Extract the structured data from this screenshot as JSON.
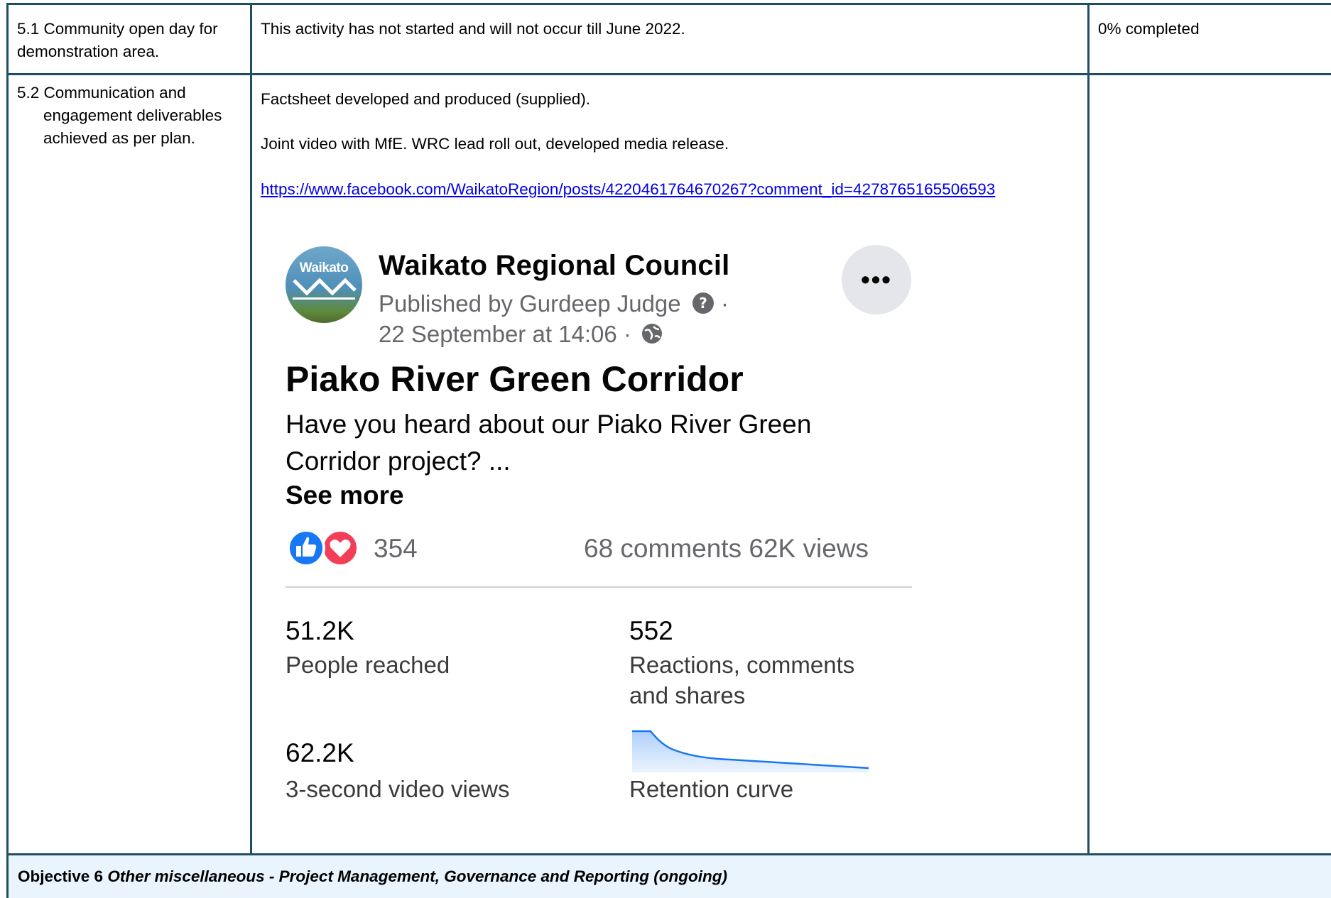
{
  "rows": [
    {
      "activity": "5.1 Community open day for demonstration area.",
      "activity_lines": [
        "5.1 Community open day for",
        "demonstration area."
      ],
      "progress": "This activity has not started and will not occur till June 2022.",
      "status": "0% completed"
    },
    {
      "activity_lines": [
        "5.2 Communication and",
        "engagement deliverables",
        "achieved as per plan."
      ],
      "progress_lines": [
        "Factsheet developed and produced (supplied).",
        "Joint video with MfE. WRC lead roll out, developed media release."
      ],
      "link": "https://www.facebook.com/WaikatoRegion/posts/4220461764670267?comment_id=4278765165506593",
      "status": ""
    }
  ],
  "facebook_post": {
    "logo_text": "Waikato",
    "page_name": "Waikato Regional Council",
    "published_by": "Published by Gurdeep Judge",
    "date": "22 September at 14:06 ·",
    "more_icon": "more-horizontal-icon",
    "title": "Piako River Green Corridor",
    "body_lines": [
      "Have you heard about our Piako River Green",
      "Corridor project? ..."
    ],
    "see_more": "See more",
    "reactions": "354",
    "comments_views": "68 comments  62K views",
    "insights": [
      {
        "value": "51.2K",
        "label_lines": [
          "People reached"
        ]
      },
      {
        "value": "552",
        "label_lines": [
          "Reactions, comments",
          "and shares"
        ]
      },
      {
        "value": "62.2K",
        "label_lines": [
          "3-second video views"
        ]
      },
      {
        "value": "",
        "label_lines": [
          "Retention curve"
        ]
      }
    ],
    "colors": {
      "like_blue": "#1877f2",
      "love_red": "#f33e58",
      "curve_blue": "#1877f2"
    }
  },
  "objective": {
    "prefix": "Objective 6",
    "text": "Other miscellaneous -  Project Management, Governance and Reporting (ongoing)"
  }
}
